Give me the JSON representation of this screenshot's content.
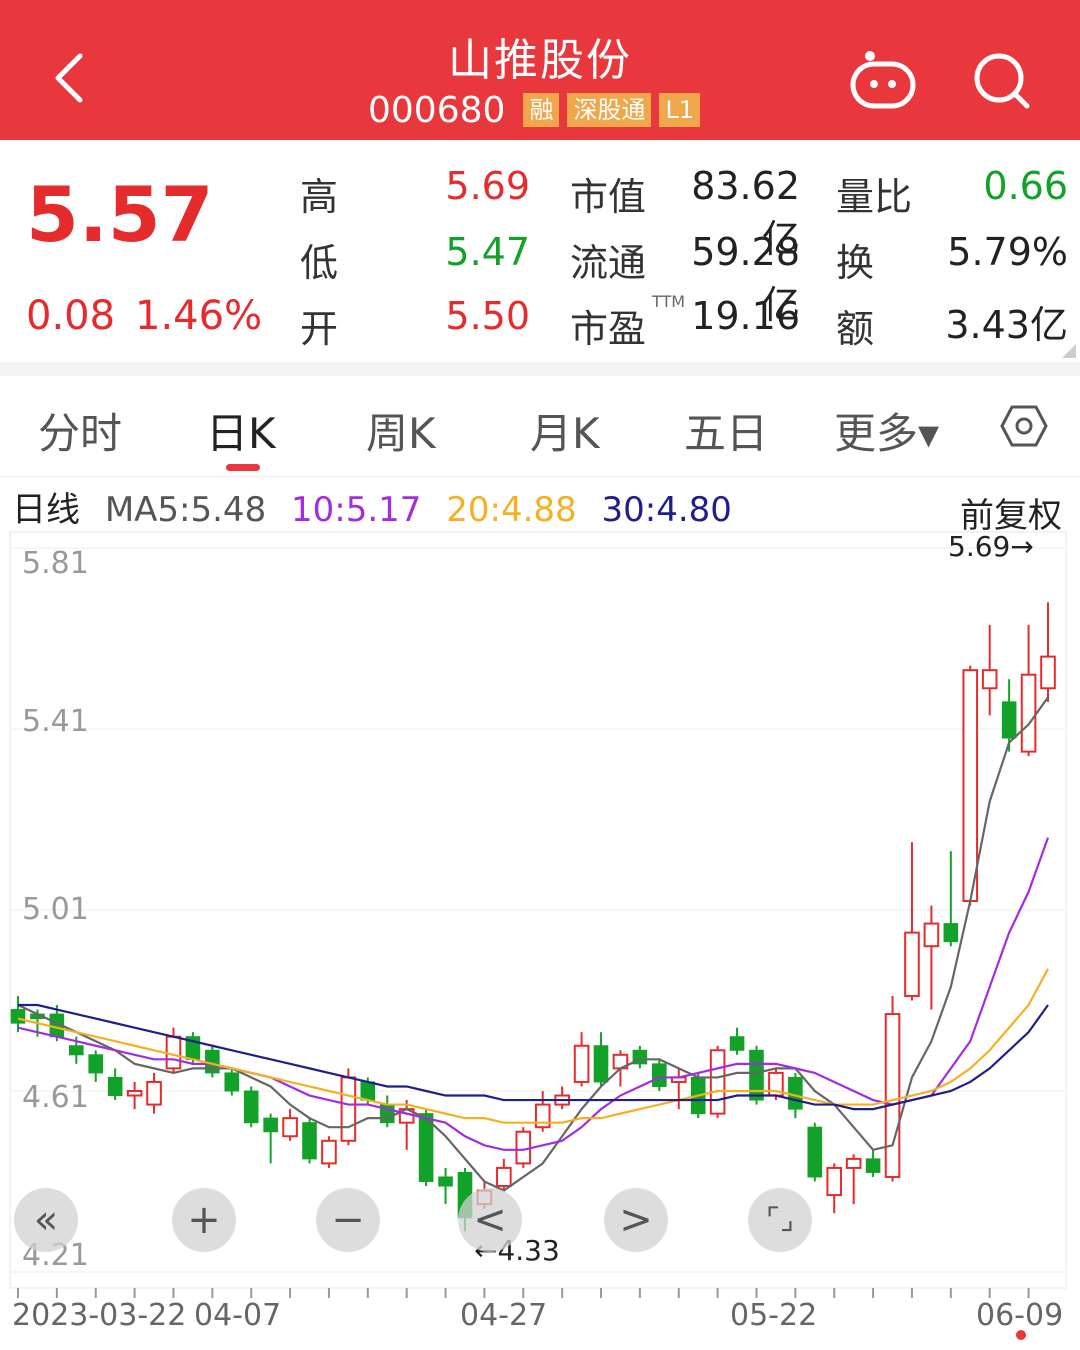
{
  "header": {
    "title": "山推股份",
    "code": "000680",
    "tags": [
      "融",
      "深股通",
      "L1"
    ]
  },
  "quote": {
    "price": "5.57",
    "change": "0.08",
    "change_pct": "1.46%",
    "high_label": "高",
    "high": "5.69",
    "low_label": "低",
    "low": "5.47",
    "open_label": "开",
    "open": "5.50",
    "mcap_label": "市值",
    "mcap": "83.62亿",
    "float_label": "流通",
    "float": "59.28亿",
    "pe_label": "市盈",
    "pe_sup": "TTM",
    "pe": "19.16",
    "volratio_label": "量比",
    "volratio": "0.66",
    "turnover_label": "换",
    "turnover": "5.79%",
    "amount_label": "额",
    "amount": "3.43亿"
  },
  "tabs": [
    "分时",
    "日K",
    "周K",
    "月K",
    "五日",
    "更多▾"
  ],
  "active_tab": "日K",
  "legend": {
    "type": "日线",
    "ma5": "MA5:5.48",
    "ma10": "10:5.17",
    "ma20": "20:4.88",
    "ma30": "30:4.80",
    "adjust": "前复权",
    "high_marker": "5.69→",
    "low_marker": "←4.33"
  },
  "colors": {
    "up": "#e52b2b",
    "down": "#13a229",
    "ma5": "#666666",
    "ma10": "#a32be0",
    "ma20": "#f5b021",
    "ma30": "#1f1f8c",
    "header": "#e8373d"
  },
  "controls": [
    "«",
    "+",
    "−",
    "<",
    ">",
    "⌜⌟"
  ],
  "chart_data": {
    "type": "candlestick",
    "ylim": [
      4.21,
      5.81
    ],
    "yticks": [
      "5.81",
      "5.41",
      "5.01",
      "4.61",
      "4.21"
    ],
    "xticks": [
      "2023-03-22",
      "04-07",
      "04-27",
      "05-22",
      "06-09"
    ],
    "candles": [
      [
        4.79,
        4.76,
        4.82,
        4.74
      ],
      [
        4.78,
        4.77,
        4.79,
        4.73
      ],
      [
        4.78,
        4.73,
        4.8,
        4.72
      ],
      [
        4.71,
        4.69,
        4.73,
        4.67
      ],
      [
        4.69,
        4.65,
        4.7,
        4.63
      ],
      [
        4.64,
        4.6,
        4.66,
        4.59
      ],
      [
        4.6,
        4.61,
        4.63,
        4.57
      ],
      [
        4.58,
        4.63,
        4.65,
        4.56
      ],
      [
        4.66,
        4.73,
        4.75,
        4.65
      ],
      [
        4.73,
        4.68,
        4.74,
        4.67
      ],
      [
        4.7,
        4.65,
        4.71,
        4.64
      ],
      [
        4.65,
        4.61,
        4.66,
        4.6
      ],
      [
        4.61,
        4.54,
        4.62,
        4.53
      ],
      [
        4.55,
        4.52,
        4.56,
        4.45
      ],
      [
        4.51,
        4.55,
        4.57,
        4.5
      ],
      [
        4.54,
        4.46,
        4.55,
        4.45
      ],
      [
        4.45,
        4.5,
        4.51,
        4.44
      ],
      [
        4.5,
        4.64,
        4.66,
        4.49
      ],
      [
        4.63,
        4.59,
        4.64,
        4.58
      ],
      [
        4.58,
        4.54,
        4.6,
        4.53
      ],
      [
        4.54,
        4.57,
        4.59,
        4.48
      ],
      [
        4.56,
        4.41,
        4.57,
        4.4
      ],
      [
        4.42,
        4.4,
        4.44,
        4.36
      ],
      [
        4.43,
        4.33,
        4.44,
        4.3
      ],
      [
        4.36,
        4.39,
        4.41,
        4.35
      ],
      [
        4.4,
        4.44,
        4.46,
        4.39
      ],
      [
        4.45,
        4.52,
        4.53,
        4.44
      ],
      [
        4.53,
        4.58,
        4.61,
        4.52
      ],
      [
        4.58,
        4.6,
        4.62,
        4.57
      ],
      [
        4.63,
        4.71,
        4.74,
        4.62
      ],
      [
        4.71,
        4.63,
        4.74,
        4.62
      ],
      [
        4.66,
        4.69,
        4.7,
        4.62
      ],
      [
        4.7,
        4.67,
        4.71,
        4.66
      ],
      [
        4.67,
        4.62,
        4.68,
        4.61
      ],
      [
        4.63,
        4.64,
        4.66,
        4.57
      ],
      [
        4.64,
        4.56,
        4.65,
        4.55
      ],
      [
        4.56,
        4.7,
        4.71,
        4.55
      ],
      [
        4.73,
        4.7,
        4.75,
        4.69
      ],
      [
        4.7,
        4.59,
        4.71,
        4.58
      ],
      [
        4.6,
        4.65,
        4.66,
        4.59
      ],
      [
        4.64,
        4.57,
        4.65,
        4.55
      ],
      [
        4.53,
        4.42,
        4.54,
        4.41
      ],
      [
        4.38,
        4.44,
        4.45,
        4.34
      ],
      [
        4.44,
        4.46,
        4.47,
        4.36
      ],
      [
        4.46,
        4.43,
        4.48,
        4.42
      ],
      [
        4.42,
        4.78,
        4.82,
        4.41
      ],
      [
        4.82,
        4.96,
        5.16,
        4.81
      ],
      [
        4.93,
        4.98,
        5.02,
        4.79
      ],
      [
        4.98,
        4.94,
        5.14,
        4.93
      ],
      [
        5.03,
        5.54,
        5.55,
        5.02
      ],
      [
        5.5,
        5.54,
        5.64,
        5.44
      ],
      [
        5.47,
        5.39,
        5.52,
        5.36
      ],
      [
        5.36,
        5.53,
        5.64,
        5.35
      ],
      [
        5.5,
        5.57,
        5.69,
        5.47
      ]
    ],
    "ma5": [
      4.8,
      4.78,
      4.76,
      4.74,
      4.72,
      4.7,
      4.67,
      4.66,
      4.65,
      4.66,
      4.66,
      4.66,
      4.64,
      4.62,
      4.58,
      4.55,
      4.53,
      4.53,
      4.55,
      4.55,
      4.57,
      4.55,
      4.51,
      4.46,
      4.41,
      4.39,
      4.42,
      4.45,
      4.51,
      4.57,
      4.62,
      4.66,
      4.68,
      4.68,
      4.66,
      4.64,
      4.64,
      4.65,
      4.65,
      4.66,
      4.66,
      4.61,
      4.58,
      4.53,
      4.48,
      4.49,
      4.64,
      4.72,
      4.84,
      5.03,
      5.25,
      5.38,
      5.42,
      5.48
    ],
    "ma10": [
      4.75,
      4.74,
      4.73,
      4.72,
      4.71,
      4.7,
      4.69,
      4.68,
      4.68,
      4.67,
      4.67,
      4.66,
      4.65,
      4.64,
      4.62,
      4.6,
      4.59,
      4.58,
      4.58,
      4.57,
      4.56,
      4.55,
      4.54,
      4.51,
      4.49,
      4.48,
      4.48,
      4.49,
      4.5,
      4.53,
      4.57,
      4.6,
      4.62,
      4.64,
      4.64,
      4.65,
      4.66,
      4.67,
      4.67,
      4.67,
      4.66,
      4.65,
      4.63,
      4.61,
      4.59,
      4.58,
      4.59,
      4.6,
      4.66,
      4.72,
      4.84,
      4.96,
      5.05,
      5.17
    ],
    "ma20": [
      4.77,
      4.76,
      4.75,
      4.74,
      4.73,
      4.72,
      4.71,
      4.7,
      4.69,
      4.68,
      4.67,
      4.66,
      4.65,
      4.64,
      4.63,
      4.62,
      4.61,
      4.6,
      4.59,
      4.58,
      4.58,
      4.57,
      4.56,
      4.55,
      4.55,
      4.54,
      4.54,
      4.54,
      4.54,
      4.55,
      4.55,
      4.56,
      4.57,
      4.58,
      4.59,
      4.6,
      4.61,
      4.61,
      4.61,
      4.61,
      4.6,
      4.59,
      4.58,
      4.58,
      4.58,
      4.59,
      4.6,
      4.61,
      4.63,
      4.66,
      4.7,
      4.75,
      4.8,
      4.88
    ],
    "ma30": [
      4.8,
      4.8,
      4.79,
      4.78,
      4.77,
      4.76,
      4.75,
      4.74,
      4.73,
      4.72,
      4.71,
      4.7,
      4.69,
      4.68,
      4.67,
      4.66,
      4.65,
      4.64,
      4.63,
      4.62,
      4.62,
      4.61,
      4.6,
      4.6,
      4.6,
      4.59,
      4.59,
      4.59,
      4.59,
      4.59,
      4.59,
      4.59,
      4.59,
      4.59,
      4.59,
      4.59,
      4.59,
      4.6,
      4.6,
      4.6,
      4.59,
      4.58,
      4.58,
      4.57,
      4.57,
      4.58,
      4.59,
      4.6,
      4.61,
      4.63,
      4.66,
      4.7,
      4.74,
      4.8
    ]
  }
}
